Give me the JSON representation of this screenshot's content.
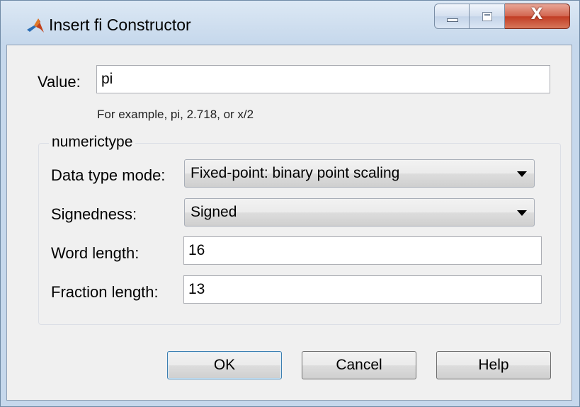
{
  "window": {
    "title": "Insert fi Constructor",
    "accent_colors": {
      "titlebar": "#c6d8ec",
      "close_button": "#c13c24",
      "default_button_border": "#3c7fb1"
    }
  },
  "titlebar_buttons": {
    "minimize_icon": "minimize-icon",
    "maximize_icon": "maximize-icon",
    "close_glyph": "X"
  },
  "value_field": {
    "label": "Value:",
    "value": "pi",
    "hint": "For example, pi, 2.718, or x/2"
  },
  "numerictype": {
    "legend": "numerictype",
    "data_type_mode": {
      "label": "Data type mode:",
      "selected": "Fixed-point: binary point scaling"
    },
    "signedness": {
      "label": "Signedness:",
      "selected": "Signed"
    },
    "word_length": {
      "label": "Word length:",
      "value": "16"
    },
    "fraction_length": {
      "label": "Fraction length:",
      "value": "13"
    }
  },
  "buttons": {
    "ok": "OK",
    "cancel": "Cancel",
    "help": "Help"
  }
}
